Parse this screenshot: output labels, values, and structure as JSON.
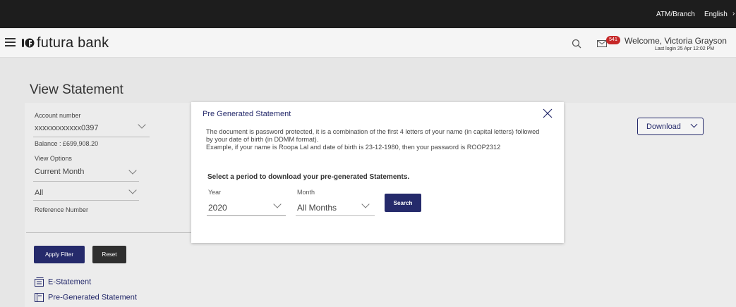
{
  "topbar": {
    "atm_branch": "ATM/Branch",
    "language": "English"
  },
  "header": {
    "brand": "futura bank",
    "notification_count": "541",
    "welcome": "Welcome, Victoria Grayson",
    "last_login": "Last login 25 Apr 12:02 PM"
  },
  "page": {
    "title": "View Statement"
  },
  "filters": {
    "account_label": "Account number",
    "account_value": "xxxxxxxxxxxx0397",
    "balance": "Balance : £699,908.20",
    "view_options_label": "View Options",
    "period_value": "Current Month",
    "type_value": "All",
    "reference_label": "Reference Number",
    "apply_label": "Apply Filter",
    "reset_label": "Reset",
    "e_statement": "E-Statement",
    "pre_generated": "Pre-Generated Statement",
    "download_label": "Download"
  },
  "modal": {
    "title": "Pre Generated Statement",
    "desc1": "The document is password protected, it is a combination of the first 4 letters of your name (in capital letters) followed by your date of birth (in DDMM format).",
    "desc2": "Example, if your name is Roopa Lal and date of birth is 23-12-1980, then your password is ROOP2312",
    "subtitle": "Select a period to download your pre-generated Statements.",
    "year_label": "Year",
    "year_value": "2020",
    "month_label": "Month",
    "month_value": "All Months",
    "search_label": "Search"
  },
  "colors": {
    "primary": "#252a6b",
    "topbar": "#1d1d1d",
    "badge": "#c62828"
  }
}
